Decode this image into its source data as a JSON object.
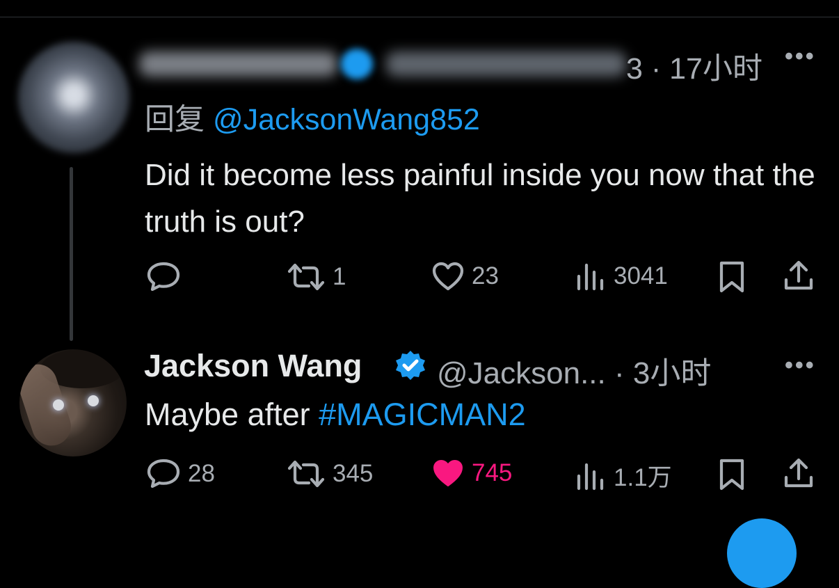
{
  "reply": {
    "time_suffix": "3 · 17小时",
    "replying_prefix": "回复 ",
    "replying_to": "@JacksonWang852",
    "text": "Did it become less painful inside you now that the truth is out?",
    "stats": {
      "replies": "",
      "reposts": "1",
      "likes": "23",
      "views": "3041"
    }
  },
  "tweet": {
    "author_name": "Jackson Wang",
    "handle": "@Jackson...",
    "time": " · 3小时",
    "text_prefix": "Maybe after ",
    "hashtag": "#MAGICMAN2",
    "stats": {
      "replies": "28",
      "reposts": "345",
      "likes": "745",
      "views": "1.1万"
    },
    "liked": true
  },
  "icons": {
    "reply": "reply-icon",
    "repost": "repost-icon",
    "like": "heart-icon",
    "views": "views-icon",
    "bookmark": "bookmark-icon",
    "share": "share-icon",
    "more": "more-icon",
    "verified": "verified-badge-icon"
  },
  "colors": {
    "background": "#000000",
    "text": "#e7e9ea",
    "secondary": "#a8adb3",
    "accent": "#1d9bf0",
    "like": "#f91880"
  }
}
